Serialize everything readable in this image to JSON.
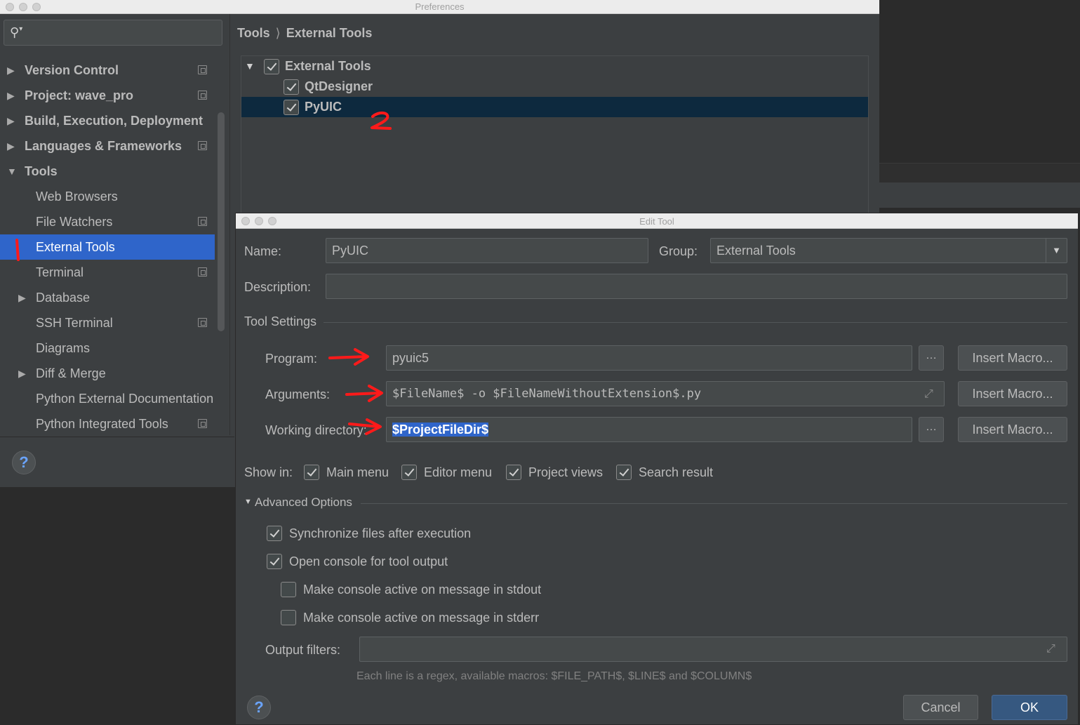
{
  "preferences": {
    "window_title": "Preferences",
    "search": {
      "placeholder": "",
      "value": ""
    },
    "sidebar_items": [
      {
        "label": "Version Control"
      },
      {
        "label": "Project: wave_pro"
      },
      {
        "label": "Build, Execution, Deployment"
      },
      {
        "label": "Languages & Frameworks"
      },
      {
        "label": "Tools"
      },
      {
        "label": "Web Browsers"
      },
      {
        "label": "File Watchers"
      },
      {
        "label": "External Tools"
      },
      {
        "label": "Terminal"
      },
      {
        "label": "Database"
      },
      {
        "label": "SSH Terminal"
      },
      {
        "label": "Diagrams"
      },
      {
        "label": "Diff & Merge"
      },
      {
        "label": "Python External Documentation"
      },
      {
        "label": "Python Integrated Tools"
      }
    ],
    "breadcrumb": [
      "Tools",
      "External Tools"
    ],
    "breadcrumb_sep": "⟩",
    "tool_tree": [
      {
        "label": "External Tools",
        "checked": true
      },
      {
        "label": "QtDesigner",
        "checked": true
      },
      {
        "label": "PyUIC",
        "checked": true
      }
    ],
    "help_label": "?"
  },
  "edit_tool": {
    "window_title": "Edit Tool",
    "name_label": "Name:",
    "name_value": "PyUIC",
    "group_label": "Group:",
    "group_value": "External Tools",
    "description_label": "Description:",
    "description_value": "",
    "tool_settings_label": "Tool Settings",
    "program_label": "Program:",
    "program_value": "pyuic5",
    "arguments_label": "Arguments:",
    "arguments_value": "$FileName$ -o $FileNameWithoutExtension$.py",
    "working_dir_label": "Working directory:",
    "working_dir_value": "$ProjectFileDir$",
    "browse_label": "…",
    "insert_macro_label": "Insert Macro...",
    "show_in_label": "Show in:",
    "show_in": [
      {
        "label": "Main menu",
        "checked": true
      },
      {
        "label": "Editor menu",
        "checked": true
      },
      {
        "label": "Project views",
        "checked": true
      },
      {
        "label": "Search result",
        "checked": true
      }
    ],
    "advanced_label": "Advanced Options",
    "advanced_options": [
      {
        "label": "Synchronize files after execution",
        "checked": true
      },
      {
        "label": "Open console for tool output",
        "checked": true
      },
      {
        "label": "Make console active on message in stdout",
        "checked": false
      },
      {
        "label": "Make console active on message in stderr",
        "checked": false
      }
    ],
    "output_filters_label": "Output filters:",
    "output_filters_value": "",
    "output_hint": "Each line is a regex, available macros: $FILE_PATH$, $LINE$ and $COLUMN$",
    "cancel_label": "Cancel",
    "ok_label": "OK",
    "help_label": "?"
  },
  "annotations": {
    "color": "#ff1a1a",
    "step1": "1",
    "step2": "2"
  }
}
